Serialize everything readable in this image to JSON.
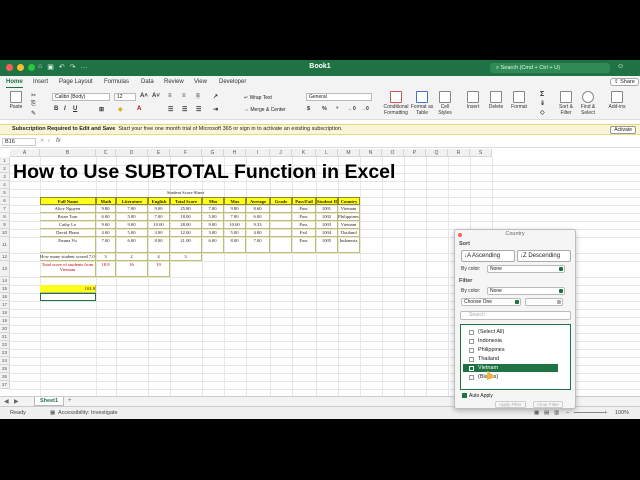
{
  "app": {
    "title": "Book1",
    "search_placeholder": "Search (Cmd + Ctrl + U)",
    "share_label": "Share",
    "brand_color": "#1f7244"
  },
  "tabs": [
    "Home",
    "Insert",
    "Page Layout",
    "Formulas",
    "Data",
    "Review",
    "View",
    "Developer"
  ],
  "ribbon": {
    "paste": "Paste",
    "font": "Calibri (Body)",
    "size": "12",
    "wrap_text": "Wrap Text",
    "merge": "Merge & Center",
    "number_format": "General",
    "conditional": "Conditional Formatting",
    "format_table": "Format as Table",
    "cell_styles": "Cell Styles",
    "insert": "Insert",
    "delete": "Delete",
    "format": "Format",
    "sort_filter": "Sort & Filter",
    "find_select": "Find & Select",
    "addins": "Add-ins"
  },
  "notice": {
    "bold": "Subscription Required to Edit and Save",
    "text": "Start your free one month trial of Microsoft 365 or sign in to activate an existing subscription.",
    "button": "Activate"
  },
  "formula_bar": {
    "name_box": "B16",
    "fx": "fx",
    "value": ""
  },
  "columns": [
    "A",
    "B",
    "C",
    "D",
    "E",
    "F",
    "G",
    "H",
    "I",
    "J",
    "K",
    "L",
    "M",
    "N",
    "O",
    "P",
    "Q",
    "R",
    "S"
  ],
  "rows": [
    "1",
    "2",
    "3",
    "4",
    "5",
    "6",
    "7",
    "8",
    "9",
    "10",
    "11",
    "12",
    "13",
    "14",
    "15",
    "16",
    "17",
    "18",
    "19",
    "20",
    "21",
    "22",
    "23",
    "24",
    "25",
    "26",
    "27"
  ],
  "overlay_title": "How to Use SUBTOTAL Function in Excel",
  "sheet": {
    "title": "Student Score Sheet",
    "headers": [
      "Full Name",
      "Math",
      "Literature",
      "English",
      "Total Score",
      "Min",
      "Max",
      "Average",
      "Grade",
      "Pass/Fail",
      "Student ID",
      "Country"
    ],
    "rows": [
      [
        "Alice Nguyen",
        "9.80",
        "7.00",
        "9.00",
        "25.80",
        "7.00",
        "9.80",
        "8.60",
        "",
        "Pass",
        "1001",
        "Vietnam"
      ],
      [
        "Brian Tran",
        "6.00",
        "5.00",
        "7.00",
        "18.00",
        "5.00",
        "7.00",
        "6.00",
        "",
        "Pass",
        "1002",
        "Philippines"
      ],
      [
        "Cathy Le",
        "9.00",
        "9.00",
        "10.00",
        "28.00",
        "9.00",
        "10.00",
        "9.33",
        "",
        "Pass",
        "1003",
        "Vietnam"
      ],
      [
        "David Pham",
        "4.00",
        "5.00",
        "3.00",
        "12.00",
        "3.00",
        "5.00",
        "4.00",
        "",
        "Fail",
        "1004",
        "Thailand"
      ],
      [
        "Emma Vu",
        "7.00",
        "6.00",
        "8.00",
        "21.00",
        "6.00",
        "8.00",
        "7.00",
        "",
        "Pass",
        "1005",
        "Indonesia"
      ]
    ],
    "count_label": "How many student scored 7.0 or higher?",
    "count_values": [
      "3",
      "2",
      "4",
      "3"
    ],
    "total_label": "Total score of students from Vietnam",
    "total_values": [
      "18.8",
      "16",
      "19"
    ],
    "sum_value": "104.8"
  },
  "sheet_tab": "Sheet1",
  "status": {
    "ready": "Ready",
    "accessibility": "Accessibility: Investigate",
    "zoom": "100%"
  },
  "filter_panel": {
    "title": "Country",
    "sort_label": "Sort",
    "ascending": "Ascending",
    "descending": "Descending",
    "by_color_label": "By color:",
    "by_color_value": "None",
    "filter_label": "Filter",
    "filter_by_color_value": "None",
    "choose_one": "Choose One",
    "search_placeholder": "Search",
    "items": [
      "(Select All)",
      "Indonesia",
      "Philippines",
      "Thailand",
      "Vietnam",
      "(Blanks)"
    ],
    "selected_item": "Vietnam",
    "auto_apply": "Auto Apply",
    "apply_filter": "Apply Filter",
    "clear_filter": "Clear Filter"
  }
}
